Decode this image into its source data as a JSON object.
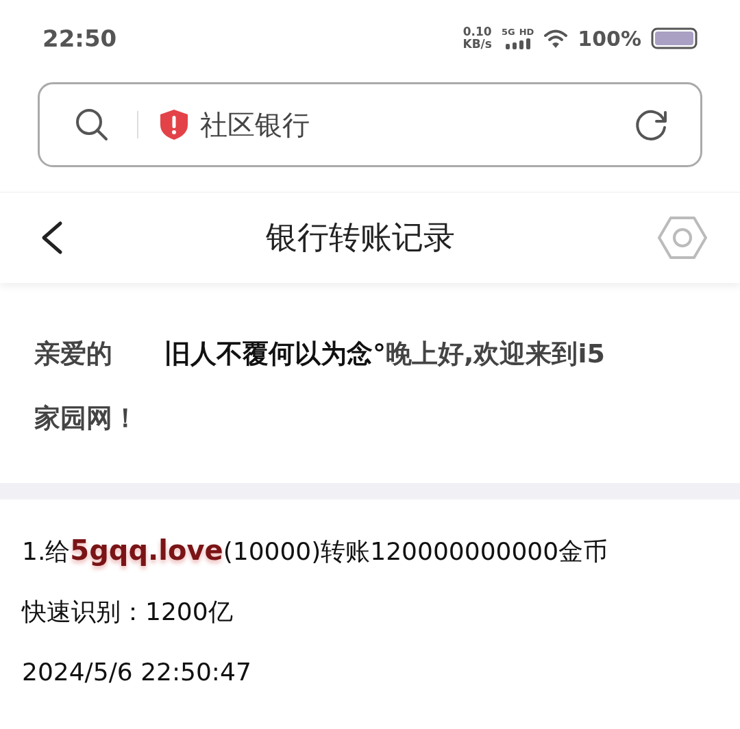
{
  "status_bar": {
    "time": "22:50",
    "net_speed": "0.10",
    "net_unit": "KB/s",
    "network_type": "5G",
    "hd": "HD",
    "battery": "100%"
  },
  "address_bar": {
    "site_name": "社区银行",
    "unsafe": true
  },
  "header": {
    "title": "银行转账记录"
  },
  "greeting": "亲爱的　　**旧人不覆何以为念°**晚上好,欢迎来到i5家园网！",
  "records": [
    {
      "description": "1.给**5gqq.love**(10000)转账120000000000金币",
      "quick_read": "快速识别：1200亿",
      "timestamp": "2024/5/6 22:50:47"
    }
  ]
}
